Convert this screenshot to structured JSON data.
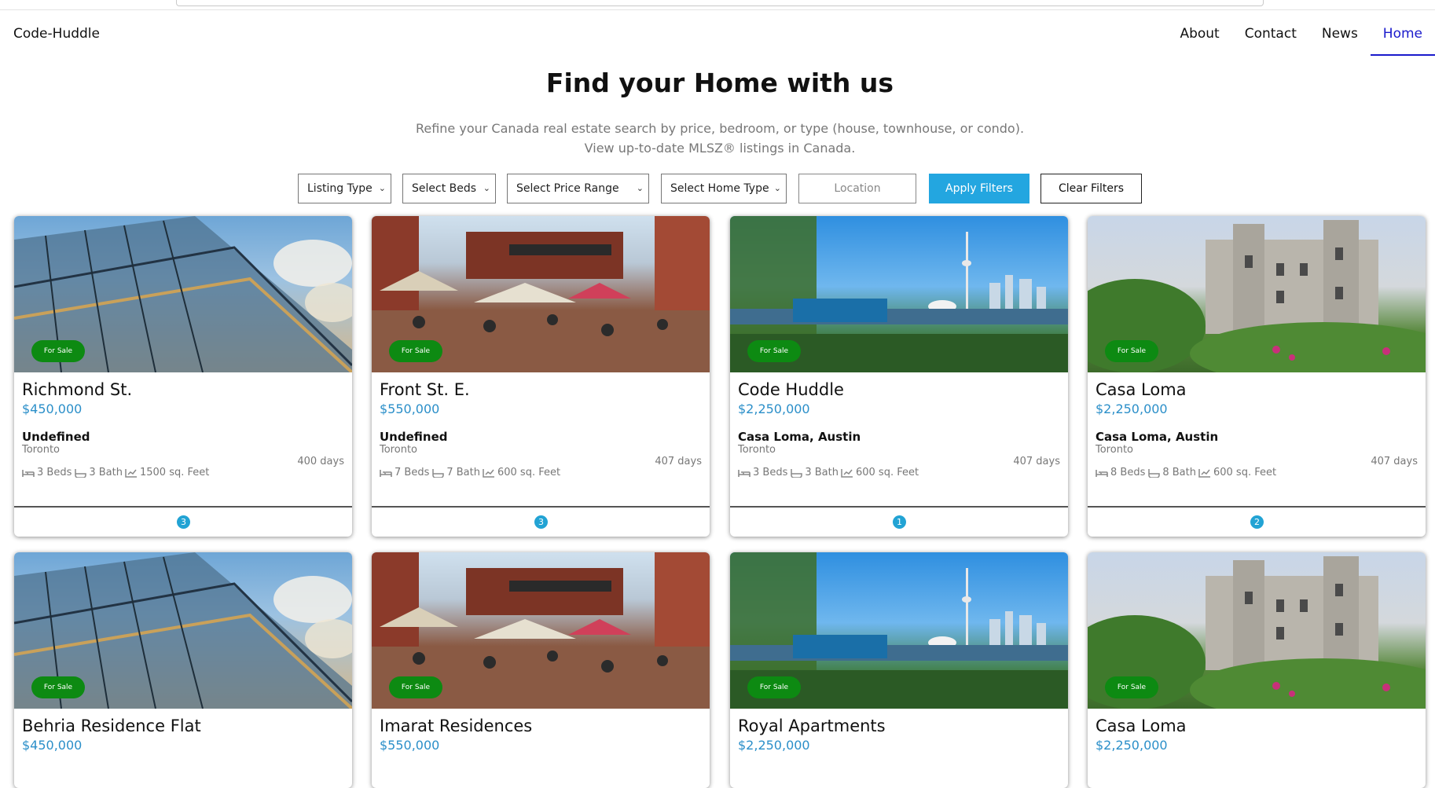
{
  "brand": "Code-Huddle",
  "nav": [
    {
      "label": "About",
      "active": false
    },
    {
      "label": "Contact",
      "active": false
    },
    {
      "label": "News",
      "active": false
    },
    {
      "label": "Home",
      "active": true
    }
  ],
  "hero": {
    "title": "Find your Home with us",
    "subtitle_line1": "Refine your Canada real estate search by price, bedroom, or type (house, townhouse, or condo).",
    "subtitle_line2": "View up-to-date MLSZ® listings in Canada."
  },
  "filters": {
    "listing_type": "Listing Type",
    "beds": "Select Beds",
    "price_range": "Select Price Range",
    "home_type": "Select Home Type",
    "location_placeholder": "Location",
    "apply_label": "Apply Filters",
    "clear_label": "Clear Filters"
  },
  "colors": {
    "accent": "#23a6e0",
    "badge": "#0d8a12",
    "price": "#2b8fc9",
    "nav_active": "#1a1acc"
  },
  "cards": [
    {
      "badge": "For Sale",
      "title": "Richmond St.",
      "price": "$450,000",
      "location": "Undefined",
      "city": "Toronto",
      "days": "400 days",
      "beds": "3 Beds",
      "baths": "3 Bath",
      "area": "1500 sq. Feet",
      "count": "3",
      "scene": "arch"
    },
    {
      "badge": "For Sale",
      "title": "Front St. E.",
      "price": "$550,000",
      "location": "Undefined",
      "city": "Toronto",
      "days": "407 days",
      "beds": "7 Beds",
      "baths": "7 Bath",
      "area": "600 sq. Feet",
      "count": "3",
      "scene": "market"
    },
    {
      "badge": "For Sale",
      "title": "Code Huddle",
      "price": "$2,250,000",
      "location": "Casa Loma, Austin",
      "city": "Toronto",
      "days": "407 days",
      "beds": "3 Beds",
      "baths": "3 Bath",
      "area": "600 sq. Feet",
      "count": "1",
      "scene": "tower"
    },
    {
      "badge": "For Sale",
      "title": "Casa Loma",
      "price": "$2,250,000",
      "location": "Casa Loma, Austin",
      "city": "Toronto",
      "days": "407 days",
      "beds": "8 Beds",
      "baths": "8 Bath",
      "area": "600 sq. Feet",
      "count": "2",
      "scene": "castle"
    },
    {
      "badge": "For Sale",
      "title": "Behria Residence Flat",
      "price": "$450,000",
      "scene": "arch"
    },
    {
      "badge": "For Sale",
      "title": "Imarat Residences",
      "price": "$550,000",
      "scene": "market"
    },
    {
      "badge": "For Sale",
      "title": "Royal Apartments",
      "price": "$2,250,000",
      "scene": "tower"
    },
    {
      "badge": "For Sale",
      "title": "Casa Loma",
      "price": "$2,250,000",
      "scene": "castle"
    }
  ]
}
